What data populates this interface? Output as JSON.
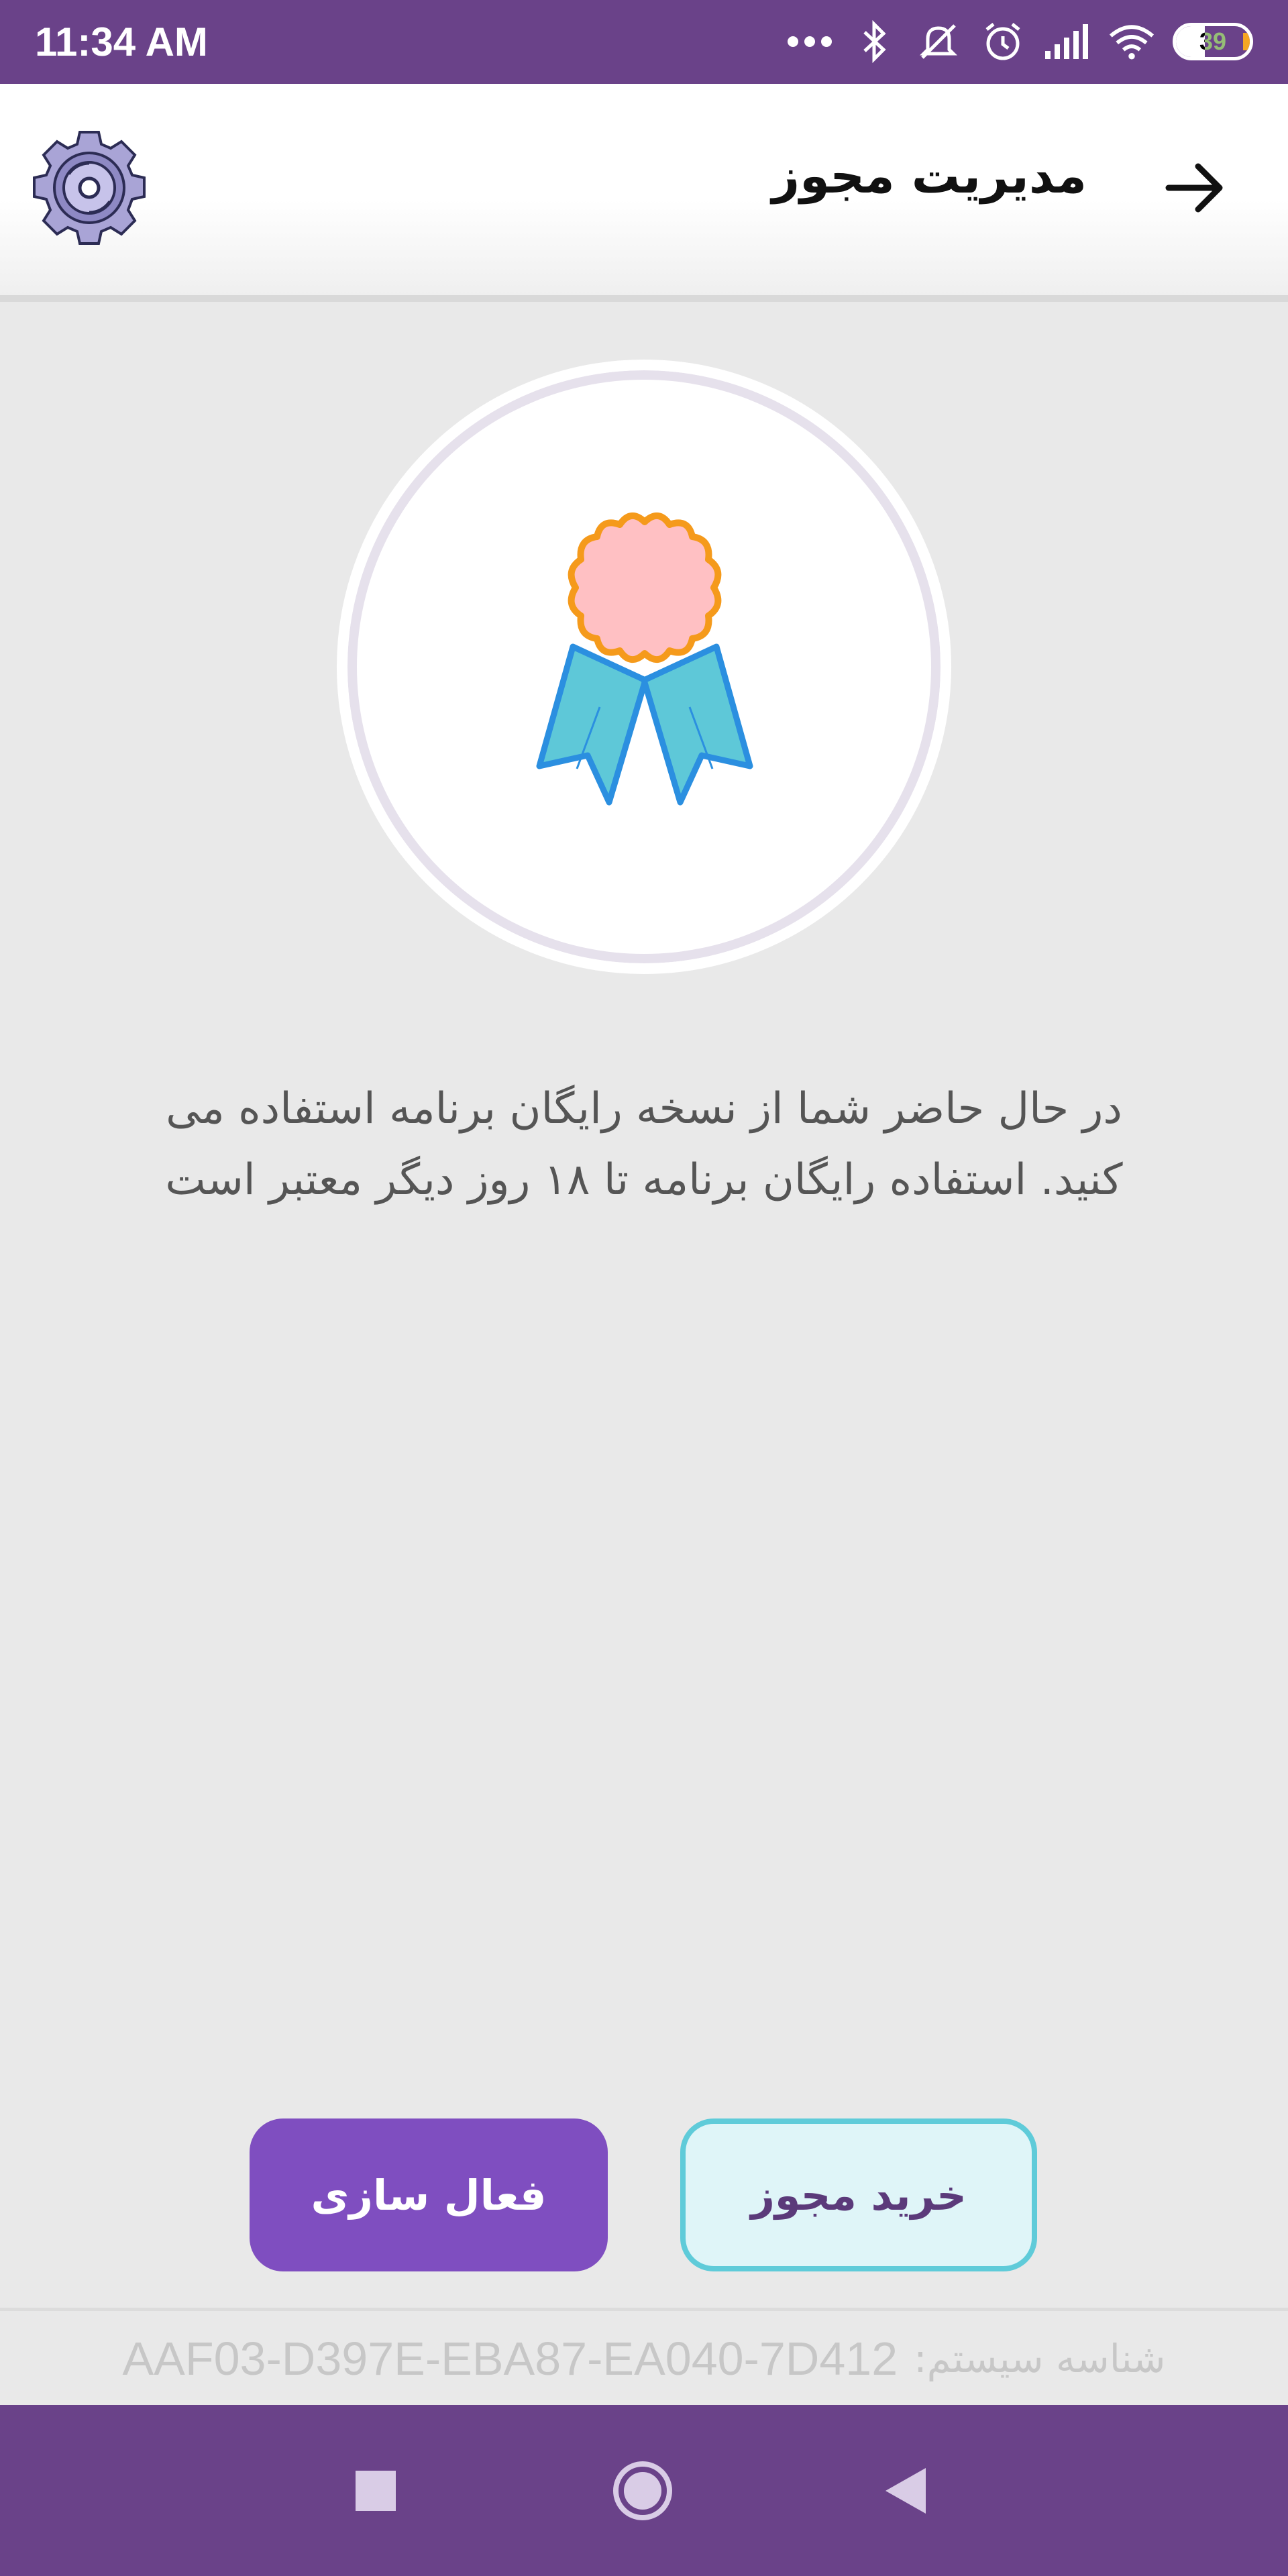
{
  "status_bar": {
    "time": "11:34 AM",
    "icons": [
      "more-dots-icon",
      "bluetooth-icon",
      "silent-icon",
      "alarm-icon",
      "signal-icon",
      "wifi-icon"
    ],
    "battery_level": "39"
  },
  "header": {
    "title": "مدیریت مجوز",
    "back_icon": "arrow-right-icon",
    "settings_icon": "gear-icon"
  },
  "badge": {
    "icon": "award-ribbon-icon",
    "colors": {
      "medal": "#ffc0c3",
      "medal_border": "#f59a1b",
      "ribbon": "#5ec8d8",
      "ribbon_border": "#2b8fe0"
    }
  },
  "message": {
    "line1": "در حال حاضر شما از نسخه رایگان برنامه استفاده می",
    "line2": "کنید. استفاده رایگان برنامه تا ۱۸ روز دیگر معتبر است"
  },
  "buttons": {
    "buy_label": "خرید مجوز",
    "activate_label": "فعال سازی"
  },
  "system_id": {
    "label": "شناسه سیستم:",
    "value": "AAF03-D397E-EBA87-EA040-7D412"
  },
  "nav": {
    "recent_icon": "square-icon",
    "home_icon": "circle-home-icon",
    "back_icon": "triangle-back-icon"
  },
  "colors": {
    "primary": "#6a4289",
    "accent": "#7f4ec0",
    "background": "#e9e9e9"
  }
}
